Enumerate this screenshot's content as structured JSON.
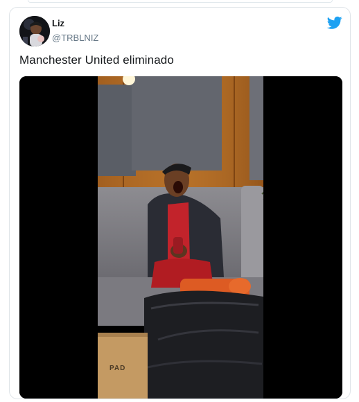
{
  "tweet": {
    "author_name": "Liz",
    "author_handle": "@TRBLNIZ",
    "text": "Manchester United eliminado",
    "icon": "twitter-bird-icon"
  },
  "media": {
    "type": "video-still",
    "box_text": "PAD"
  },
  "colors": {
    "brand": "#1da1f2",
    "name": "#14171a",
    "handle": "#657786",
    "border": "#dfe4e8"
  }
}
